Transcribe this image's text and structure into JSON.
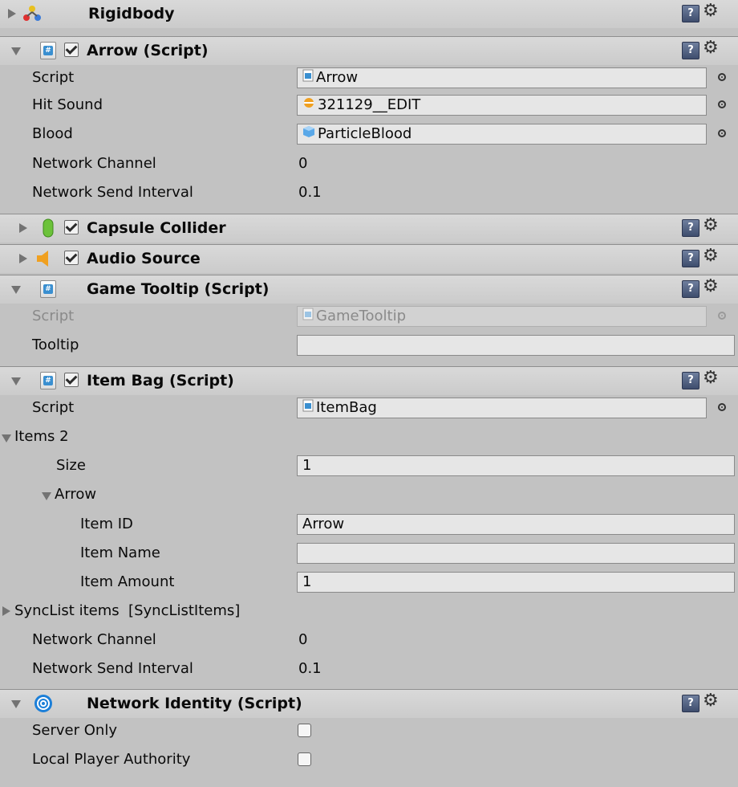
{
  "components": {
    "rigidbody": {
      "title": "Rigidbody"
    },
    "arrow": {
      "title": "Arrow (Script)",
      "script": {
        "label": "Script",
        "value": "Arrow"
      },
      "hit_sound": {
        "label": "Hit Sound",
        "value": "321129__EDIT"
      },
      "blood": {
        "label": "Blood",
        "value": "ParticleBlood"
      },
      "network_channel": {
        "label": "Network Channel",
        "value": "0"
      },
      "network_send_interval": {
        "label": "Network Send Interval",
        "value": "0.1"
      }
    },
    "capsule_collider": {
      "title": "Capsule Collider"
    },
    "audio_source": {
      "title": "Audio Source"
    },
    "game_tooltip": {
      "title": "Game Tooltip (Script)",
      "script": {
        "label": "Script",
        "value": "GameTooltip"
      },
      "tooltip": {
        "label": "Tooltip",
        "value": ""
      }
    },
    "item_bag": {
      "title": "Item Bag (Script)",
      "script": {
        "label": "Script",
        "value": "ItemBag"
      },
      "items": {
        "label": "Items 2",
        "size_label": "Size",
        "size_value": "1",
        "element_label": "Arrow",
        "item_id_label": "Item ID",
        "item_id_value": "Arrow",
        "item_name_label": "Item Name",
        "item_name_value": "",
        "item_amount_label": "Item Amount",
        "item_amount_value": "1"
      },
      "synclist": {
        "label": "SyncList items  [SyncListItems]"
      },
      "network_channel": {
        "label": "Network Channel",
        "value": "0"
      },
      "network_send_interval": {
        "label": "Network Send Interval",
        "value": "0.1"
      }
    },
    "network_identity": {
      "title": "Network Identity (Script)",
      "server_only": {
        "label": "Server Only",
        "checked": false
      },
      "local_player_authority": {
        "label": "Local Player Authority",
        "checked": false
      }
    }
  },
  "icons": {
    "help": "help-book-icon",
    "settings": "gear-icon",
    "object_picker": "object-picker-icon"
  },
  "colors": {
    "panel_bg": "#c2c2c2",
    "header_bg": "#d2d2d2",
    "field_bg": "#e6e6e6",
    "script_icon_blue": "#3a8fd0",
    "audio_icon_orange": "#f0a020",
    "capsule_icon_green": "#6cc23a",
    "network_icon_blue": "#1c7fd8"
  }
}
